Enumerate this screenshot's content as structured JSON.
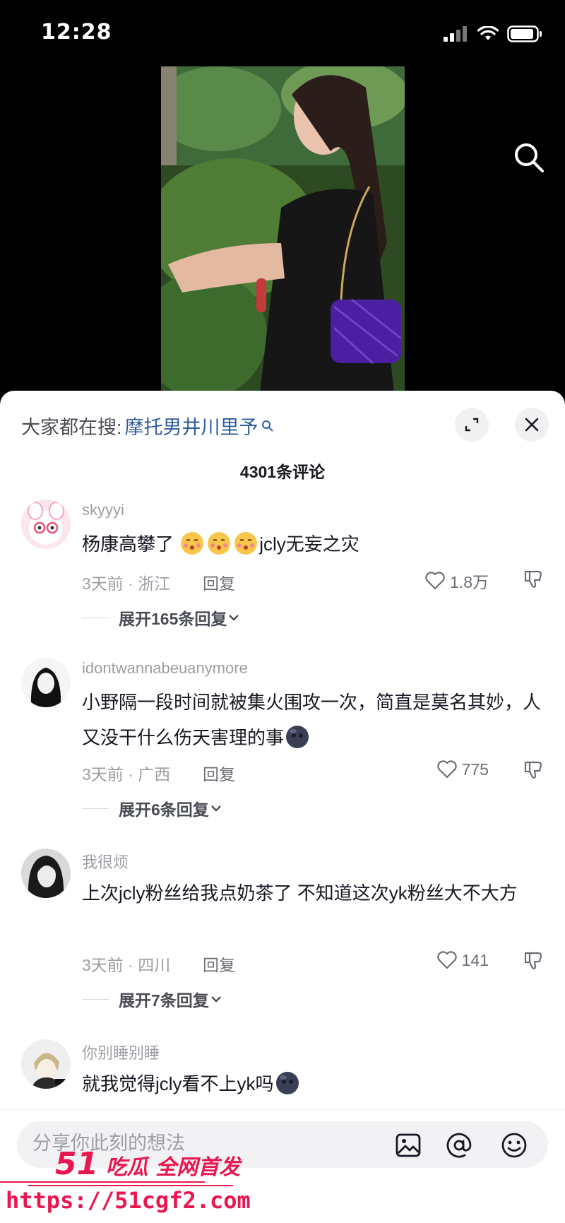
{
  "status": {
    "time": "12:28"
  },
  "sheet": {
    "hot_search_label": "大家都在搜:",
    "hot_search_keyword": "摩托男井川里予",
    "comment_count": "4301条评论"
  },
  "comments": [
    {
      "username": "skyyyi",
      "text_before_emoji": "杨康高攀了",
      "text_after_emoji": "jcly无妄之灾",
      "emoji": "kiss-face-emoji",
      "time_location": "3天前 · 浙江",
      "reply_label": "回复",
      "likes": "1.8万",
      "expand_label": "展开165条回复"
    },
    {
      "username": "idontwannabeuanymore",
      "text": "小野隔一段时间就被集火围攻一次，简直是莫名其妙，人又没干什么伤天害理的事",
      "emoji": "dark-blob-emoji",
      "time_location": "3天前 · 广西",
      "reply_label": "回复",
      "likes": "775",
      "expand_label": "展开6条回复"
    },
    {
      "username": "我很烦",
      "text": "上次jcly粉丝给我点奶茶了 不知道这次yk粉丝大不大方",
      "time_location": "3天前 · 四川",
      "reply_label": "回复",
      "likes": "141",
      "expand_label": "展开7条回复"
    },
    {
      "username": "你别睡别睡",
      "text": "就我觉得jcly看不上yk吗",
      "emoji": "dark-blob-emoji"
    }
  ],
  "input": {
    "placeholder": "分享你此刻的想法"
  },
  "watermark": {
    "logo_num": "51",
    "logo_text": "吃瓜 全网首发",
    "url": "https://51cgf2.com"
  },
  "colors": {
    "accent": "#e8174f",
    "keyword": "#2f5d9b",
    "muted": "#9d9ea3"
  },
  "icons": [
    "search-icon",
    "expand-icon",
    "close-icon",
    "heart-icon",
    "dislike-icon",
    "image-icon",
    "at-icon",
    "emoji-icon",
    "signal-icon",
    "wifi-icon",
    "battery-icon"
  ]
}
